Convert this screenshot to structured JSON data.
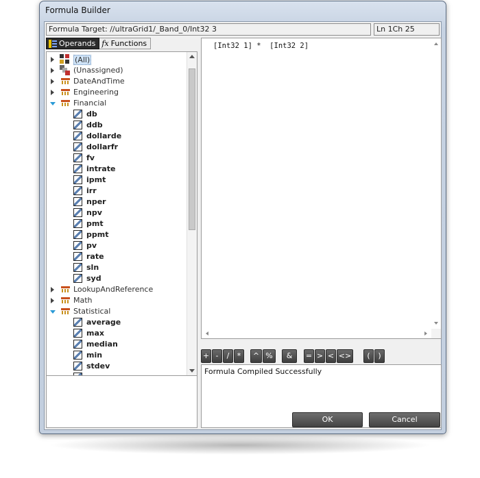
{
  "window": {
    "title": "Formula Builder"
  },
  "header": {
    "target": "Formula Target: //ultraGrid1/_Band_0/Int32 3",
    "position": "Ln 1Ch 25"
  },
  "tabs": [
    {
      "label": "Operands",
      "icon": "operands-icon",
      "active": true
    },
    {
      "label": "Functions",
      "icon": "fx-icon",
      "active": false
    }
  ],
  "tree": {
    "all_label": "(All)",
    "unassigned_label": "(Unassigned)",
    "categories": [
      "DateAndTime",
      "Engineering",
      "Financial",
      "LookupAndReference",
      "Math",
      "Statistical"
    ],
    "financial_functions": [
      "db",
      "ddb",
      "dollarde",
      "dollarfr",
      "fv",
      "intrate",
      "ipmt",
      "irr",
      "nper",
      "npv",
      "pmt",
      "ppmt",
      "pv",
      "rate",
      "sln",
      "syd"
    ],
    "statistical_functions": [
      "average",
      "max",
      "median",
      "min",
      "stdev",
      "var"
    ]
  },
  "editor": {
    "formula": "[Int32 1] *  [Int32 2]"
  },
  "operators": [
    "+",
    "-",
    "/",
    "*",
    "^",
    "%",
    "&",
    "=",
    ">",
    "<",
    "<>",
    "(",
    ")"
  ],
  "status": {
    "message": "Formula Compiled Successfully"
  },
  "buttons": {
    "ok": "OK",
    "cancel": "Cancel"
  }
}
